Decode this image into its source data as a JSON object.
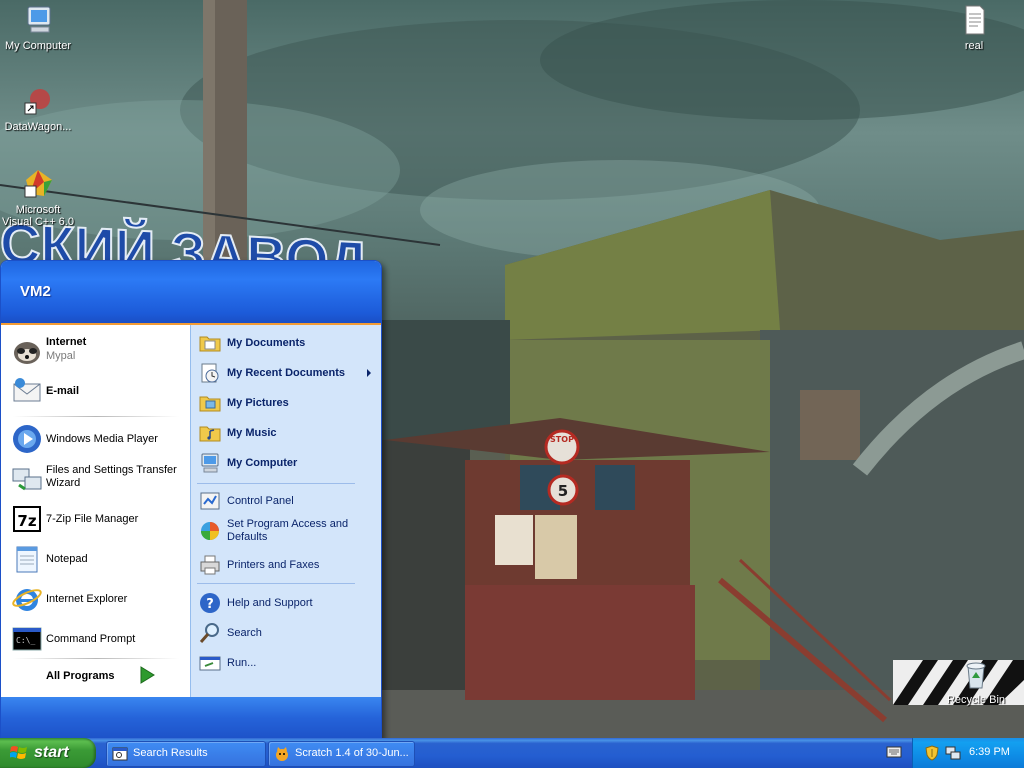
{
  "desktop": {
    "icons": [
      {
        "label": "My Computer",
        "icon": "my-computer-icon"
      },
      {
        "label": "DataWagon...",
        "icon": "datawagon-shortcut-icon"
      },
      {
        "label": "Microsoft Visual C++ 6.0",
        "icon": "visual-cpp-shortcut-icon"
      },
      {
        "label": "real",
        "icon": "text-document-icon"
      },
      {
        "label": "Recycle Bin",
        "icon": "recycle-bin-icon"
      }
    ],
    "wallpaper_sign": "СКИЙ ЗАВОД",
    "booth_signs": {
      "stop": "STOP",
      "number": "5"
    }
  },
  "start_menu": {
    "user": "VM2",
    "pinned": [
      {
        "label": "Internet",
        "sub": "Mypal",
        "icon": "mypal-browser-icon"
      },
      {
        "label": "E-mail",
        "icon": "email-icon"
      }
    ],
    "recent": [
      {
        "label": "Windows Media Player",
        "icon": "media-player-icon"
      },
      {
        "label": "Files and Settings Transfer Wizard",
        "icon": "transfer-wizard-icon"
      },
      {
        "label": "7-Zip File Manager",
        "icon": "seven-zip-icon"
      },
      {
        "label": "Notepad",
        "icon": "notepad-icon"
      },
      {
        "label": "Internet Explorer",
        "icon": "internet-explorer-icon"
      },
      {
        "label": "Command Prompt",
        "icon": "command-prompt-icon"
      }
    ],
    "all_programs": "All Programs",
    "places": [
      {
        "label": "My Documents",
        "icon": "folder-documents-icon"
      },
      {
        "label": "My Recent Documents",
        "icon": "recent-documents-icon"
      },
      {
        "label": "My Pictures",
        "icon": "folder-pictures-icon"
      },
      {
        "label": "My Music",
        "icon": "folder-music-icon"
      },
      {
        "label": "My Computer",
        "icon": "my-computer-icon"
      }
    ],
    "system": [
      {
        "label": "Control Panel",
        "icon": "control-panel-icon"
      },
      {
        "label": "Set Program Access and Defaults",
        "icon": "program-access-icon"
      },
      {
        "label": "Printers and Faxes",
        "icon": "printer-icon"
      }
    ],
    "help": [
      {
        "label": "Help and Support",
        "icon": "help-icon"
      },
      {
        "label": "Search",
        "icon": "search-icon"
      },
      {
        "label": "Run...",
        "icon": "run-icon"
      }
    ]
  },
  "taskbar": {
    "start_label": "start",
    "tasks": [
      {
        "label": "Search Results",
        "icon": "search-window-icon"
      },
      {
        "label": "Scratch 1.4 of 30-Jun...",
        "icon": "scratch-cat-icon"
      }
    ],
    "clock": "6:39 PM"
  },
  "colors": {
    "start_menu_header": "#1f66e0",
    "start_menu_right_panel": "#d3e5fa",
    "taskbar": "#245ed1",
    "start_button": "#3b9b36",
    "tray": "#0e8ce6",
    "orange_accent": "#f39c34"
  }
}
